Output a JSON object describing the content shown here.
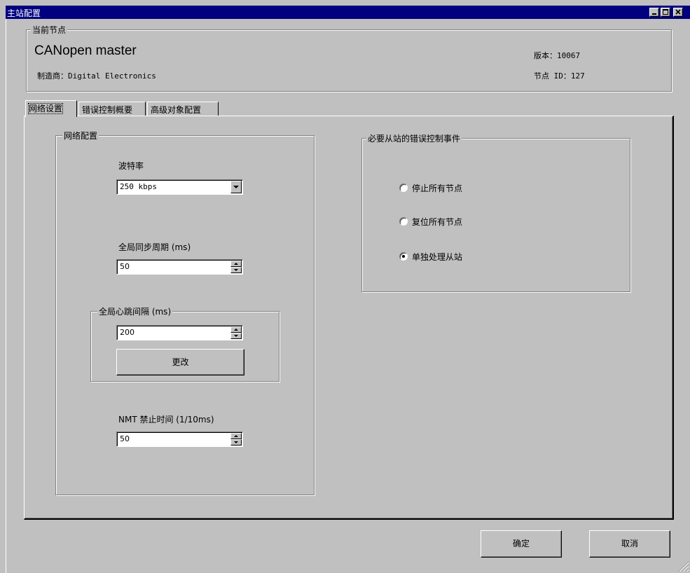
{
  "window": {
    "title": "主站配置"
  },
  "current_node": {
    "group_title": "当前节点",
    "name": "CANopen master",
    "manufacturer": "制造商：Digital Electronics",
    "version": "版本：10067",
    "node_id": "节点 ID：127"
  },
  "tabs": [
    {
      "label": "网络设置",
      "active": true
    },
    {
      "label": "错误控制概要",
      "active": false
    },
    {
      "label": "高级对象配置",
      "active": false
    }
  ],
  "network_config": {
    "group_title": "网络配置",
    "baud_label": "波特率",
    "baud_value": "250 kbps",
    "sync_label": "全局同步周期 (ms)",
    "sync_value": "50",
    "heartbeat_group_title": "全局心跳间隔 (ms)",
    "heartbeat_value": "200",
    "change_button": "更改",
    "nmt_label": "NMT 禁止时间 (1/10ms)",
    "nmt_value": "50"
  },
  "error_control": {
    "group_title": "必要从站的错误控制事件",
    "options": [
      {
        "label": "停止所有节点",
        "checked": false
      },
      {
        "label": "复位所有节点",
        "checked": false
      },
      {
        "label": "单独处理从站",
        "checked": true
      }
    ]
  },
  "footer": {
    "ok": "确定",
    "cancel": "取消"
  }
}
